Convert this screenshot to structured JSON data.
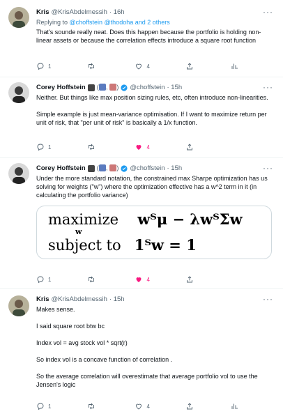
{
  "tweets": [
    {
      "name": "Kris",
      "handle": "@KrisAbdelmessih",
      "time": "· 16h",
      "reply_prefix": "Replying to ",
      "reply_user1": "@choffstein",
      "reply_user2": "@thodoha",
      "reply_suffix": " and 2 others",
      "text": "That's sounde really neat. Does this happen because the portfolio is holding non-linear assets or because the correlation effects introduce a square root function",
      "replies": "1",
      "retweets": "",
      "likes": "4"
    },
    {
      "name": "Corey Hoffstein",
      "handle": "@choffstein",
      "time": "· 15h",
      "text": "Neither.  But things like max position sizing rules, etc, often introduce non-linearities.\n\nSimple example is just mean-variance optimisation.  If I want to maximize return per unit of risk, that \"per unit of risk\" is basically a 1/x function.",
      "replies": "1",
      "retweets": "",
      "likes": "4"
    },
    {
      "name": "Corey Hoffstein",
      "handle": "@choffstein",
      "time": "· 15h",
      "text": "Under the more standard notation, the constrained max Sharpe optimization has us solving for weights (\"w\") where the optimization effective has a w^2 term in it (in calculating the portfolio variance)",
      "math": {
        "line1_label": "maximize",
        "line1_sub": "w",
        "line1_expr": "wᵀμ − λwᵀΣw",
        "line2_label": "subject to",
        "line2_expr": "1ᵀw = 1"
      },
      "replies": "1",
      "retweets": "",
      "likes": "4"
    },
    {
      "name": "Kris",
      "handle": "@KrisAbdelmessih",
      "time": "· 15h",
      "text": "Makes sense.\n\nI said square root btw bc\n\nIndex vol = avg stock vol * sqrt(r)\n\nSo index vol is a concave function of correlation .\n\nSo the average correlation will overestimate that average portfolio vol to use the Jensen's logic",
      "replies": "1",
      "retweets": "",
      "likes": "4"
    }
  ],
  "colors": {
    "text": "#0f1419",
    "muted": "#536471",
    "link": "#1d9bf0",
    "like": "#f91880",
    "border": "#cfd9de"
  },
  "icons": [
    "reply-icon",
    "retweet-icon",
    "like-icon",
    "share-icon",
    "analytics-icon",
    "more-icon",
    "verified-icon"
  ]
}
